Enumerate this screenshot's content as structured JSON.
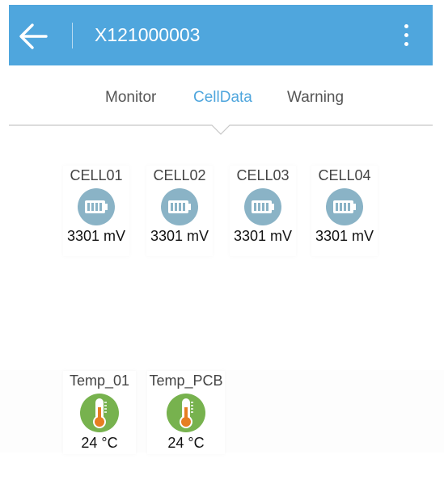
{
  "header": {
    "title": "X121000003"
  },
  "tabs": [
    {
      "label": "Monitor"
    },
    {
      "label": "CellData"
    },
    {
      "label": "Warning"
    }
  ],
  "cells": [
    {
      "label": "CELL01",
      "value": "3301 mV"
    },
    {
      "label": "CELL02",
      "value": "3301 mV"
    },
    {
      "label": "CELL03",
      "value": "3301 mV"
    },
    {
      "label": "CELL04",
      "value": "3301 mV"
    }
  ],
  "temps": [
    {
      "label": "Temp_01",
      "value": "24 °C"
    },
    {
      "label": "Temp_PCB",
      "value": "24 °C"
    }
  ],
  "colors": {
    "header": "#4fa6dd",
    "active_tab": "#4fa6dd",
    "battery_circle": "#8ab3c6",
    "thermo_circle": "#77b24e",
    "thermo_bulb": "#e67e22"
  },
  "icons": {
    "back": "arrow-left-icon",
    "menu": "more-vertical-icon",
    "cell": "battery-icon",
    "temp": "thermometer-icon"
  }
}
